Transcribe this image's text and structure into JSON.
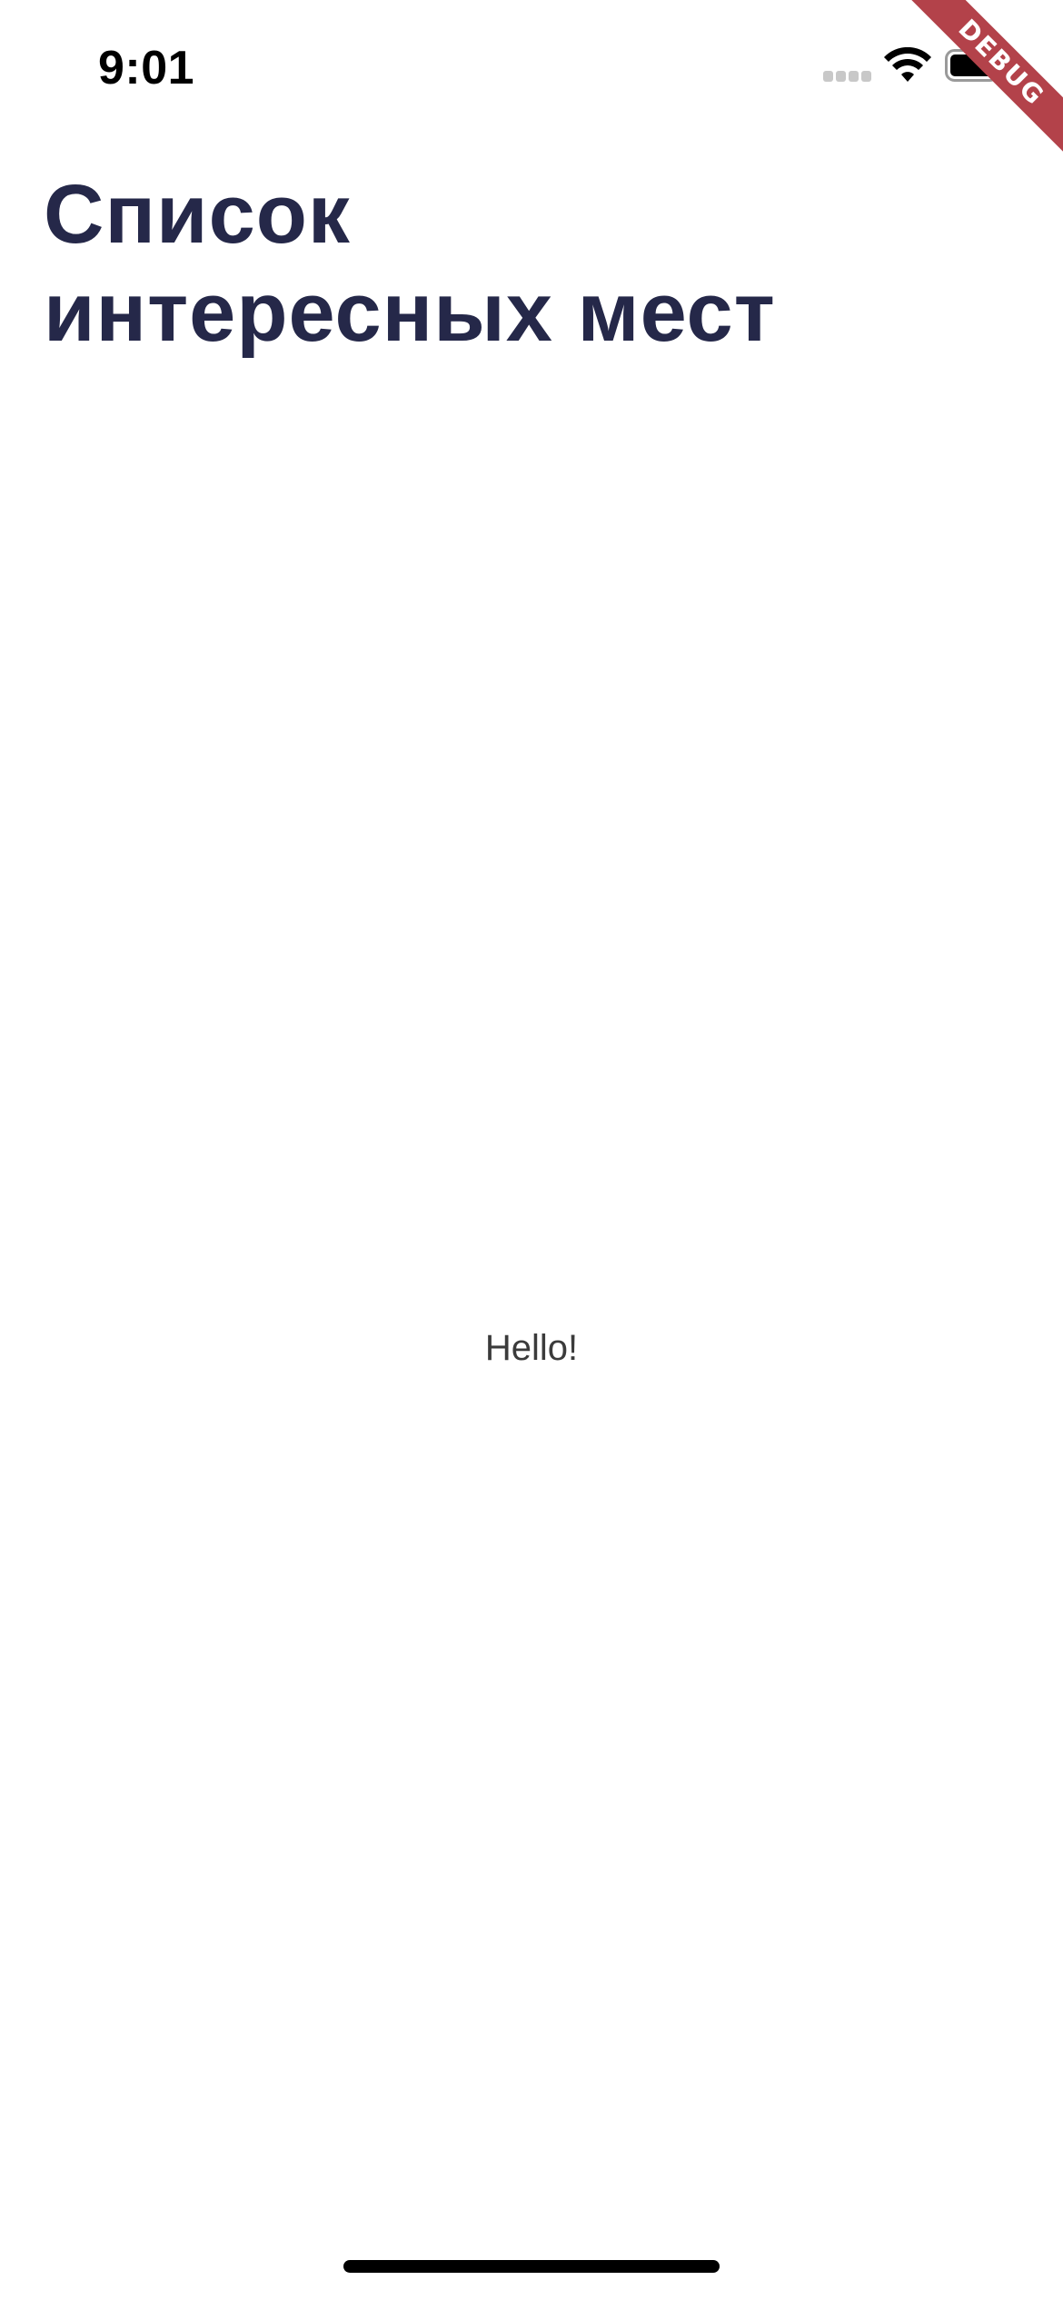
{
  "status_bar": {
    "time": "9:01",
    "icons": [
      "signal-icon",
      "wifi-icon",
      "battery-icon"
    ]
  },
  "debug_banner": {
    "label": "DEBUG",
    "color": "#b3424a"
  },
  "header": {
    "title_line1": "Список",
    "title_line2": "интересных мест",
    "title_color": "#252849"
  },
  "main": {
    "body_text": "Hello!"
  },
  "home_indicator": {
    "icon": "home-indicator"
  }
}
